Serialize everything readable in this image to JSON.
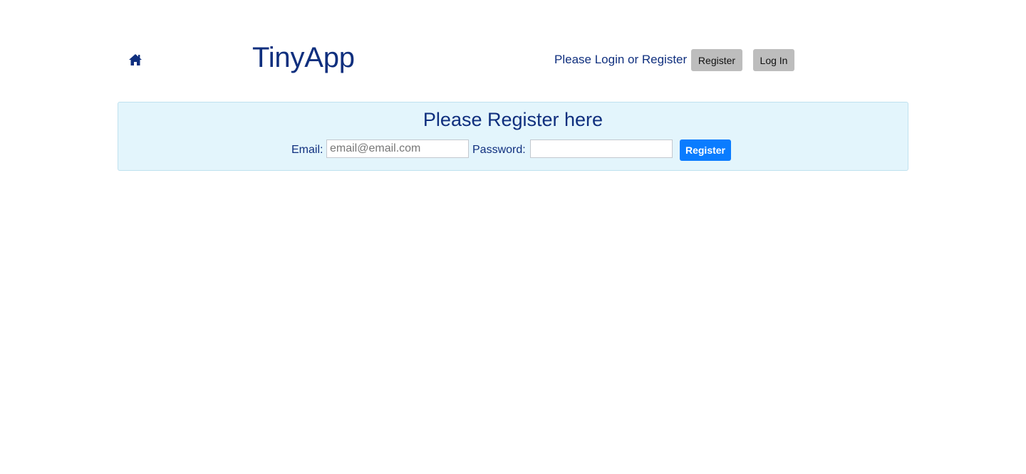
{
  "header": {
    "home_icon": "home-icon",
    "brand": "TinyApp",
    "prompt": "Please Login or Register",
    "register_label": "Register",
    "login_label": "Log In"
  },
  "register_form": {
    "title": "Please Register here",
    "email_label": "Email:",
    "email_placeholder": "email@email.com",
    "email_value": "",
    "password_label": "Password:",
    "password_value": "",
    "submit_label": "Register"
  },
  "colors": {
    "text": "#0f2f7e",
    "panel_bg": "#e3f5fc",
    "panel_border": "#bfe1ef",
    "nav_button_bg": "#bdbdbd",
    "primary_button_bg": "#0a7cff"
  }
}
